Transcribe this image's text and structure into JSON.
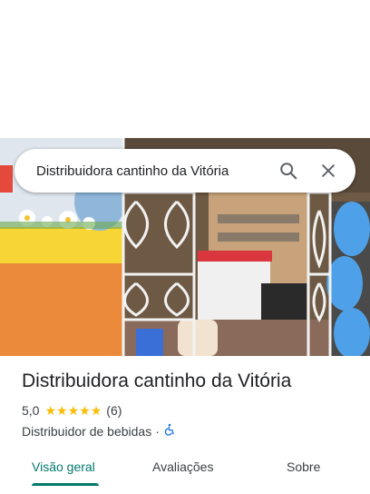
{
  "search": {
    "query": "Distribuidora cantinho da Vitória"
  },
  "place": {
    "name": "Distribuidora cantinho da Vitória",
    "rating": "5,0",
    "stars": 5,
    "review_count": "(6)",
    "category": "Distribuidor de bebidas",
    "separator": "·"
  },
  "tabs": [
    {
      "label": "Visão geral",
      "active": true
    },
    {
      "label": "Avaliações",
      "active": false
    },
    {
      "label": "Sobre",
      "active": false
    }
  ],
  "colors": {
    "accent": "#00796b",
    "star": "#fbbc04"
  },
  "icons": {
    "search": "search-icon",
    "close": "close-icon",
    "accessibility": "wheelchair-icon"
  }
}
